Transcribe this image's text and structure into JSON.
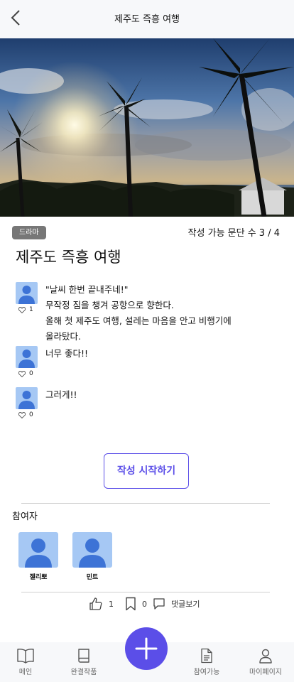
{
  "header": {
    "title": "제주도 즉흥 여행"
  },
  "story": {
    "genre": "드라마",
    "paragraph_count_label": "작성 가능 문단 수 3 / 4",
    "title": "제주도 즉흥 여행"
  },
  "paragraphs": [
    {
      "likes": "1",
      "lines": [
        "\"날씨 한번 끝내주네!\"",
        "무작정 짐을 챙겨 공항으로 향한다.",
        "올해 첫 제주도 여행, 설레는 마음을 안고 비행기에",
        "올라탔다."
      ]
    },
    {
      "likes": "0",
      "lines": [
        "너무 좋다!!"
      ]
    },
    {
      "likes": "0",
      "lines": [
        "그러게!!"
      ]
    }
  ],
  "start_button_label": "작성 시작하기",
  "participants": {
    "label": "참여자",
    "people": [
      {
        "name": "젤리뽀"
      },
      {
        "name": "민트"
      }
    ]
  },
  "stats": {
    "likes": "1",
    "bookmarks": "0",
    "comments_label": "댓글보기"
  },
  "tabbar": {
    "items": [
      {
        "label": "메인",
        "icon": "book-open-icon"
      },
      {
        "label": "완결작품",
        "icon": "book-icon"
      },
      {
        "label": "참여가능",
        "icon": "document-icon"
      },
      {
        "label": "마이페이지",
        "icon": "person-icon"
      }
    ],
    "fab_icon": "plus-icon"
  },
  "colors": {
    "accent": "#5b4ee8",
    "avatar_bg": "#a6c8f4",
    "avatar_fg": "#3d73d6",
    "genre_badge": "#777777"
  }
}
